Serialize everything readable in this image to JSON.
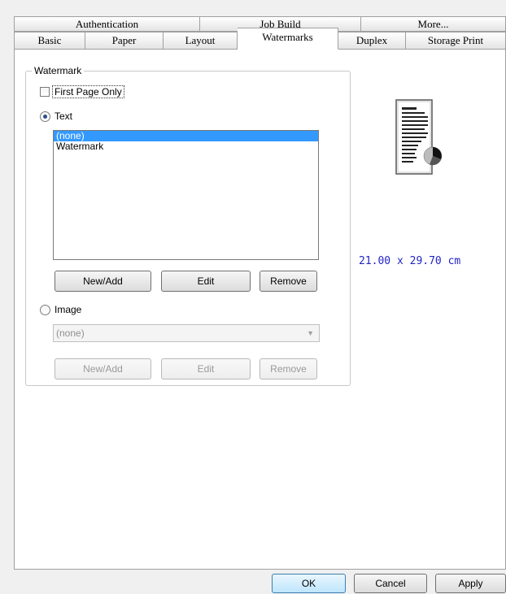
{
  "tabs": {
    "back_row": [
      "Authentication",
      "Job Build",
      "More..."
    ],
    "front_row": [
      "Basic",
      "Paper",
      "Layout",
      "Watermarks",
      "Duplex",
      "Storage Print"
    ],
    "active": "Watermarks"
  },
  "watermark": {
    "group_label": "Watermark",
    "first_page_only": {
      "label": "First Page Only",
      "checked": false
    },
    "text_option": {
      "label": "Text",
      "selected": true
    },
    "text_list": [
      {
        "label": "(none)",
        "selected": true
      },
      {
        "label": "Watermark",
        "selected": false
      }
    ],
    "text_buttons": {
      "new_add": "New/Add",
      "edit": "Edit",
      "remove": "Remove"
    },
    "image_option": {
      "label": "Image",
      "selected": false
    },
    "image_combo": {
      "value": "(none)"
    },
    "image_buttons": {
      "new_add": "New/Add",
      "edit": "Edit",
      "remove": "Remove"
    }
  },
  "preview": {
    "paper_size": "21.00 x 29.70 cm"
  },
  "footer": {
    "ok": "OK",
    "cancel": "Cancel",
    "apply": "Apply"
  }
}
